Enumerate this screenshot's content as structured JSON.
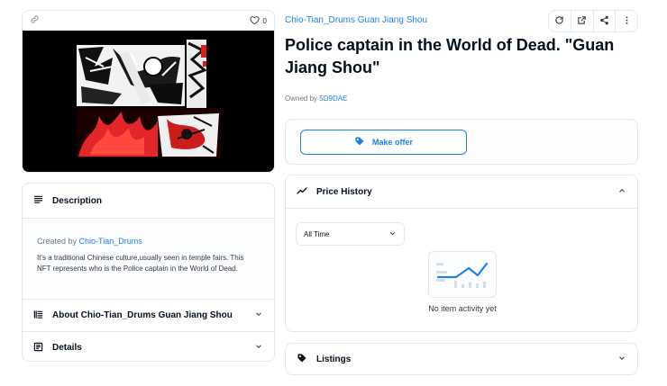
{
  "image_card": {
    "like_count": "0"
  },
  "description": {
    "header": "Description",
    "created_by_prefix": "Created by",
    "creator": "Chio-Tian_Drums",
    "text": "It's a traditional Chinese culture,usually seen in temple fairs. This NFT represents who is the Police captain in the World of Dead."
  },
  "about": {
    "header": "About Chio-Tian_Drums Guan Jiang Shou"
  },
  "details": {
    "header": "Details"
  },
  "collection": {
    "name": "Chio-Tian_Drums Guan Jiang Shou"
  },
  "item": {
    "title": "Police captain in the World of Dead. \"Guan Jiang Shou\"",
    "owned_by_prefix": "Owned by",
    "owner": "5D9DAE"
  },
  "offer": {
    "label": "Make offer"
  },
  "price_history": {
    "header": "Price History",
    "time_filter": "All Time",
    "empty_text": "No item activity yet"
  },
  "listings": {
    "header": "Listings"
  },
  "colors": {
    "accent": "#2081e2",
    "border": "#e5e8eb",
    "text": "#04111d",
    "muted": "#707a83"
  },
  "icons": [
    "link-icon",
    "heart-icon",
    "refresh-icon",
    "external-link-icon",
    "share-icon",
    "more-vertical-icon",
    "tag-icon",
    "trend-icon",
    "chevron-up-icon",
    "chevron-down-icon",
    "list-icon",
    "about-icon",
    "details-icon"
  ]
}
